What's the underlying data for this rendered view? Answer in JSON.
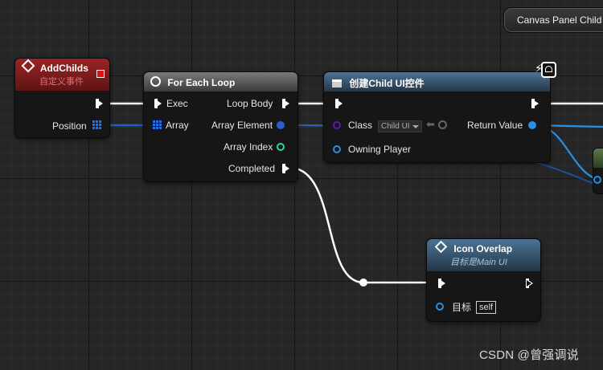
{
  "canvas_child": {
    "label": "Canvas Panel Child"
  },
  "add_childs": {
    "title": "AddChilds",
    "subtitle": "自定义事件",
    "position_label": "Position"
  },
  "for_each": {
    "title": "For Each Loop",
    "exec_label": "Exec",
    "array_label": "Array",
    "loop_body_label": "Loop Body",
    "array_element_label": "Array Element",
    "array_index_label": "Array Index",
    "completed_label": "Completed"
  },
  "create_widget": {
    "title": "创建Child UI控件",
    "class_label": "Class",
    "class_value": "Child UI",
    "owning_player_label": "Owning Player",
    "return_value_label": "Return Value"
  },
  "icon_overlap": {
    "title": "Icon Overlap",
    "subtitle": "目标是Main UI",
    "target_label": "目标",
    "target_value": "self"
  },
  "watermark": "CSDN @曾强调说",
  "colors": {
    "event_header": "#8c1a1a",
    "func_header": "#3f6a8a",
    "macro_header": "#4a4a4a",
    "exec_wire": "#ffffff",
    "object_wire": "#2a7fd4",
    "array_wire": "#1e5fc8",
    "int_pin": "#2fd4a0",
    "class_pin": "#5a1aa8"
  },
  "icons": {
    "event_icon": "diamond-icon",
    "loop_icon": "loop-icon",
    "widget_icon": "widget-icon",
    "function_icon": "function-icon",
    "lightning_icon": "lightning-icon"
  }
}
